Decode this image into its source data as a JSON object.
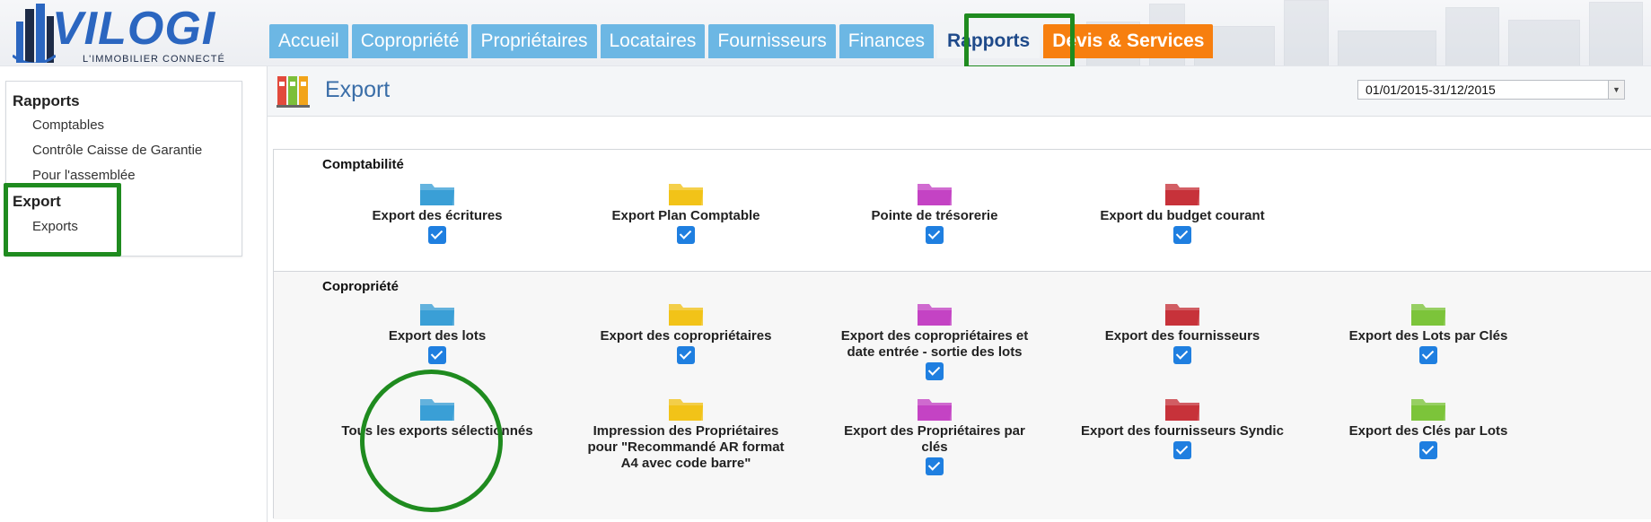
{
  "colors": {
    "tab_blue": "#6cb7e4",
    "tab_orange": "#f77f0f",
    "highlight_green": "#1f8b1f",
    "check_blue": "#1f7fe0"
  },
  "logo": {
    "text": "VILOGI",
    "subtitle": "L'IMMOBILIER CONNECTÉ"
  },
  "tabs": [
    {
      "label": "Accueil"
    },
    {
      "label": "Copropriété"
    },
    {
      "label": "Propriétaires"
    },
    {
      "label": "Locataires"
    },
    {
      "label": "Fournisseurs"
    },
    {
      "label": "Finances"
    },
    {
      "label": "Rapports",
      "active": true
    },
    {
      "label": "Devis & Services"
    }
  ],
  "sidebar": {
    "head1": "Rapports",
    "items1": [
      "Comptables",
      "Contrôle Caisse de Garantie",
      "Pour l'assemblée"
    ],
    "head2": "Export",
    "items2": [
      "Exports"
    ]
  },
  "main": {
    "title": "Export",
    "date_range": "01/01/2015-31/12/2015"
  },
  "sections": [
    {
      "title": "Comptabilité",
      "items": [
        {
          "label": "Export des écritures",
          "color": "#3a9fd6",
          "checked": true
        },
        {
          "label": "Export Plan Comptable",
          "color": "#f2c318",
          "checked": true
        },
        {
          "label": "Pointe de trésorerie",
          "color": "#c443c4",
          "checked": true
        },
        {
          "label": "Export du budget courant",
          "color": "#c7323a",
          "checked": true
        }
      ]
    },
    {
      "title": "Copropriété",
      "items": [
        {
          "label": "Export des lots",
          "color": "#3a9fd6",
          "checked": true
        },
        {
          "label": "Export des copropriétaires",
          "color": "#f2c318",
          "checked": true
        },
        {
          "label": "Export des copropriétaires et date entrée - sortie des lots",
          "color": "#c443c4",
          "checked": true
        },
        {
          "label": "Export des fournisseurs",
          "color": "#c7323a",
          "checked": true
        },
        {
          "label": "Export des Lots par Clés",
          "color": "#7cc43a",
          "checked": true
        },
        {
          "label": "Tous les exports sélectionnés",
          "color": "#3a9fd6",
          "checked": false
        },
        {
          "label": "Impression des Propriétaires pour \"Recommandé AR format A4 avec code barre\"",
          "color": "#f2c318",
          "checked": false
        },
        {
          "label": "Export des Propriétaires par clés",
          "color": "#c443c4",
          "checked": true
        },
        {
          "label": "Export des fournisseurs Syndic",
          "color": "#c7323a",
          "checked": true
        },
        {
          "label": "Export des Clés par Lots",
          "color": "#7cc43a",
          "checked": true
        }
      ]
    }
  ]
}
